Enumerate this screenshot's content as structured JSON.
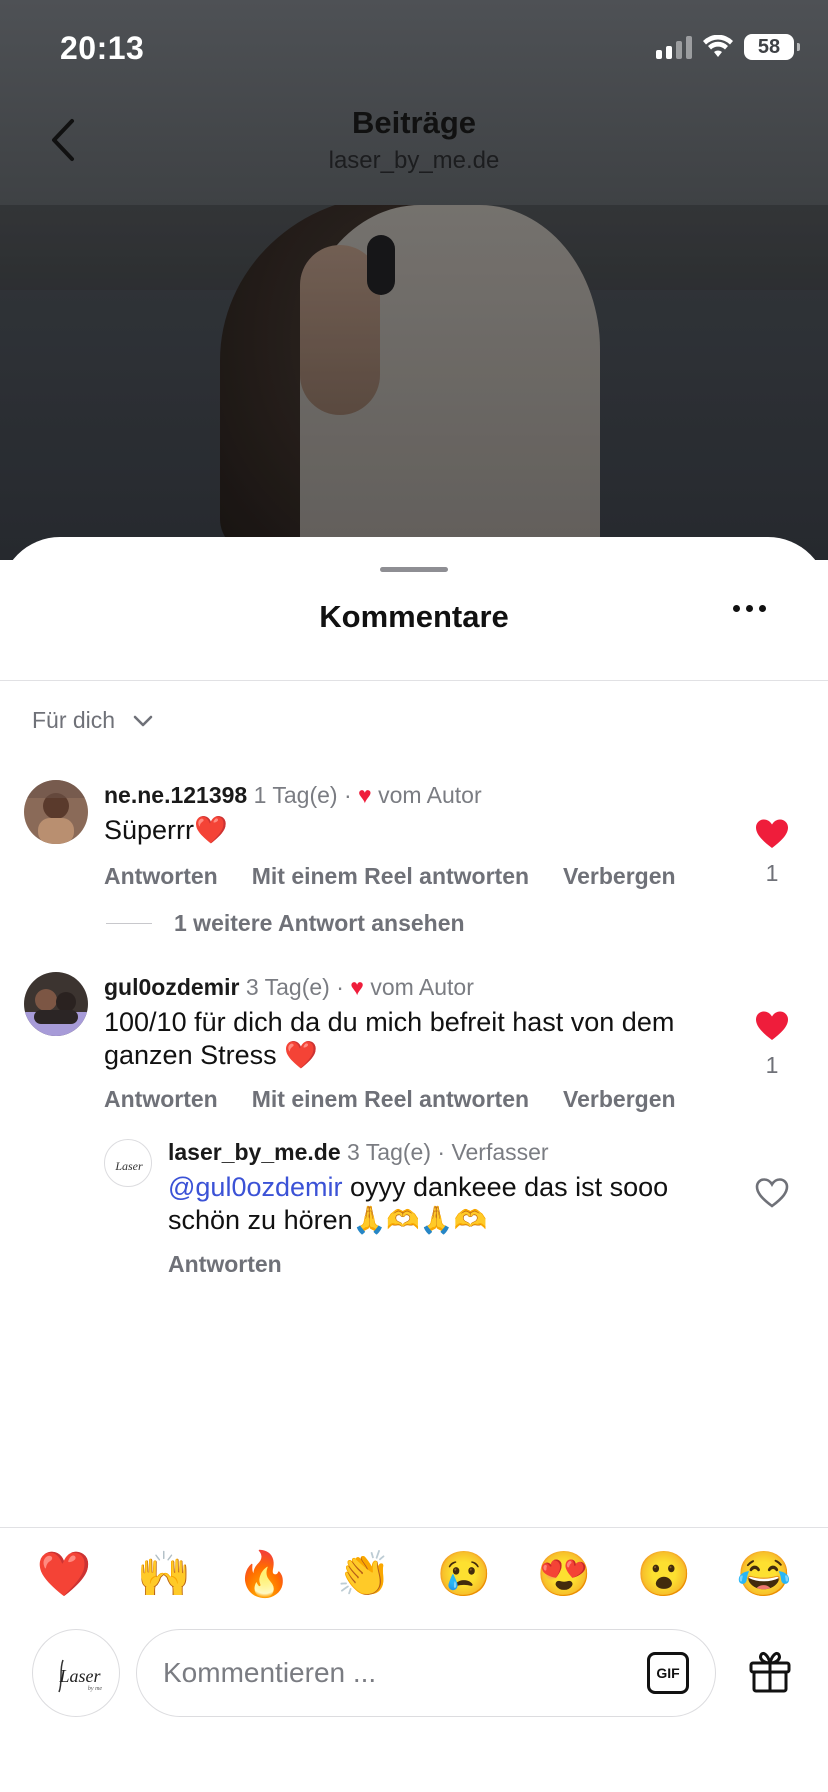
{
  "status_bar": {
    "time": "20:13",
    "battery": "58"
  },
  "nav": {
    "title": "Beiträge",
    "subtitle": "laser_by_me.de"
  },
  "sheet": {
    "title": "Kommentare"
  },
  "filter": {
    "label": "Für dich"
  },
  "comments": [
    {
      "username": "ne.ne.121398",
      "time": "1 Tag(e)",
      "author_like_label": "vom Autor",
      "text": "Süperrr❤️",
      "actions": [
        "Antworten",
        "Mit einem Reel antworten",
        "Verbergen"
      ],
      "like_count": "1",
      "liked": true,
      "more_replies": "1 weitere Antwort ansehen"
    },
    {
      "username": "gul0ozdemir",
      "time": "3 Tag(e)",
      "author_like_label": "vom Autor",
      "text": "100/10 für dich da du mich befreit hast von dem ganzen Stress ❤️",
      "actions": [
        "Antworten",
        "Mit einem Reel antworten",
        "Verbergen"
      ],
      "like_count": "1",
      "liked": true,
      "replies": [
        {
          "username": "laser_by_me.de",
          "time": "3 Tag(e)",
          "badge": "Verfasser",
          "mention": "@gul0ozdemir",
          "text": " oyyy dankeee das ist sooo schön zu hören🙏🫶🙏🫶",
          "actions": [
            "Antworten"
          ],
          "liked": false
        }
      ]
    }
  ],
  "emoji_bar": [
    "❤️",
    "🙌",
    "🔥",
    "👏",
    "😢",
    "😍",
    "😮",
    "😂"
  ],
  "composer": {
    "placeholder": "Kommentieren ...",
    "gif_label": "GIF"
  },
  "icons": {
    "back": "chevron-left-icon",
    "more": "more-horizontal-icon",
    "filter_chevron": "chevron-down-icon",
    "like": "heart-icon",
    "gift": "gift-icon",
    "gif": "gif-icon"
  },
  "colors": {
    "heart": "#ef1d3b",
    "mention": "#3b52d6",
    "muted": "#6f7178"
  }
}
